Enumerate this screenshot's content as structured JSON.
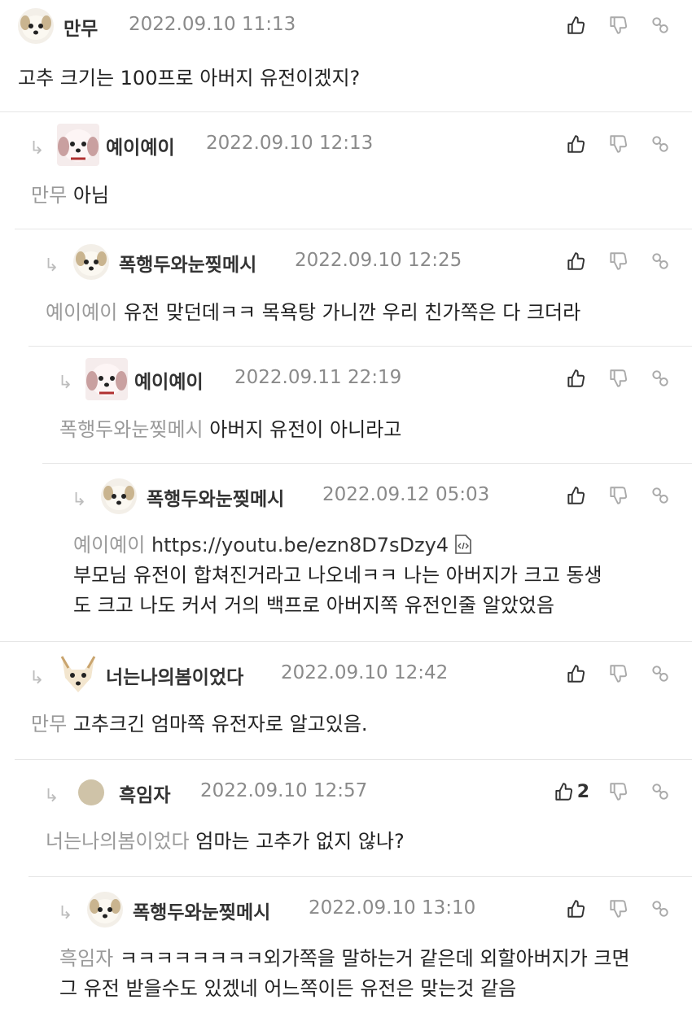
{
  "comments": [
    {
      "author": "만무",
      "time": "2022.09.10 11:13",
      "mention": "",
      "text": "고추 크기는 100프로 아버지 유전이겠지?",
      "likes": ""
    },
    {
      "author": "예이예이",
      "time": "2022.09.10 12:13",
      "mention": "만무",
      "text": "아님",
      "likes": ""
    },
    {
      "author": "폭행두와눈찢메시",
      "time": "2022.09.10 12:25",
      "mention": "예이예이",
      "text": "유전 맞던데ㅋㅋ 목욕탕 가니깐 우리 친가쪽은 다 크더라",
      "likes": ""
    },
    {
      "author": "예이예이",
      "time": "2022.09.11 22:19",
      "mention": "폭행두와눈찢메시",
      "text": "아버지 유전이 아니라고",
      "likes": ""
    },
    {
      "author": "폭행두와눈찢메시",
      "time": "2022.09.12 05:03",
      "mention": "예이예이",
      "url": "https://youtu.be/ezn8D7sDzy4",
      "text_line1": "부모님 유전이 합쳐진거라고 나오네ㅋㅋ 나는 아버지가 크고 동생",
      "text_line2": "도 크고 나도 커서 거의 백프로 아버지쪽 유전인줄 알았었음",
      "likes": ""
    },
    {
      "author": "너는나의봄이었다",
      "time": "2022.09.10 12:42",
      "mention": "만무",
      "text": "고추크긴 엄마쪽 유전자로 알고있음.",
      "likes": ""
    },
    {
      "author": "흑임자",
      "time": "2022.09.10 12:57",
      "mention": "너는나의봄이었다",
      "text": "엄마는 고추가 없지 않나?",
      "likes": "2"
    },
    {
      "author": "폭행두와눈찢메시",
      "time": "2022.09.10 13:10",
      "mention": "흑임자",
      "text_line1": "ㅋㅋㅋㅋㅋㅋㅋㅋ외가쪽을 말하는거 같은데 외할아버지가 크면",
      "text_line2": "그 유전 받을수도 있겠네 어느쪽이든 유전은 맞는것 같음",
      "likes": ""
    }
  ],
  "icons": {
    "like": "thumbs-up-icon",
    "dislike": "thumbs-down-icon",
    "link": "link-icon",
    "reply": "reply-arrow-icon",
    "embed": "code-embed-icon"
  },
  "colors": {
    "mention": "#9a9a9a",
    "time": "#8a8a8a",
    "divider": "#e6e6e6"
  }
}
